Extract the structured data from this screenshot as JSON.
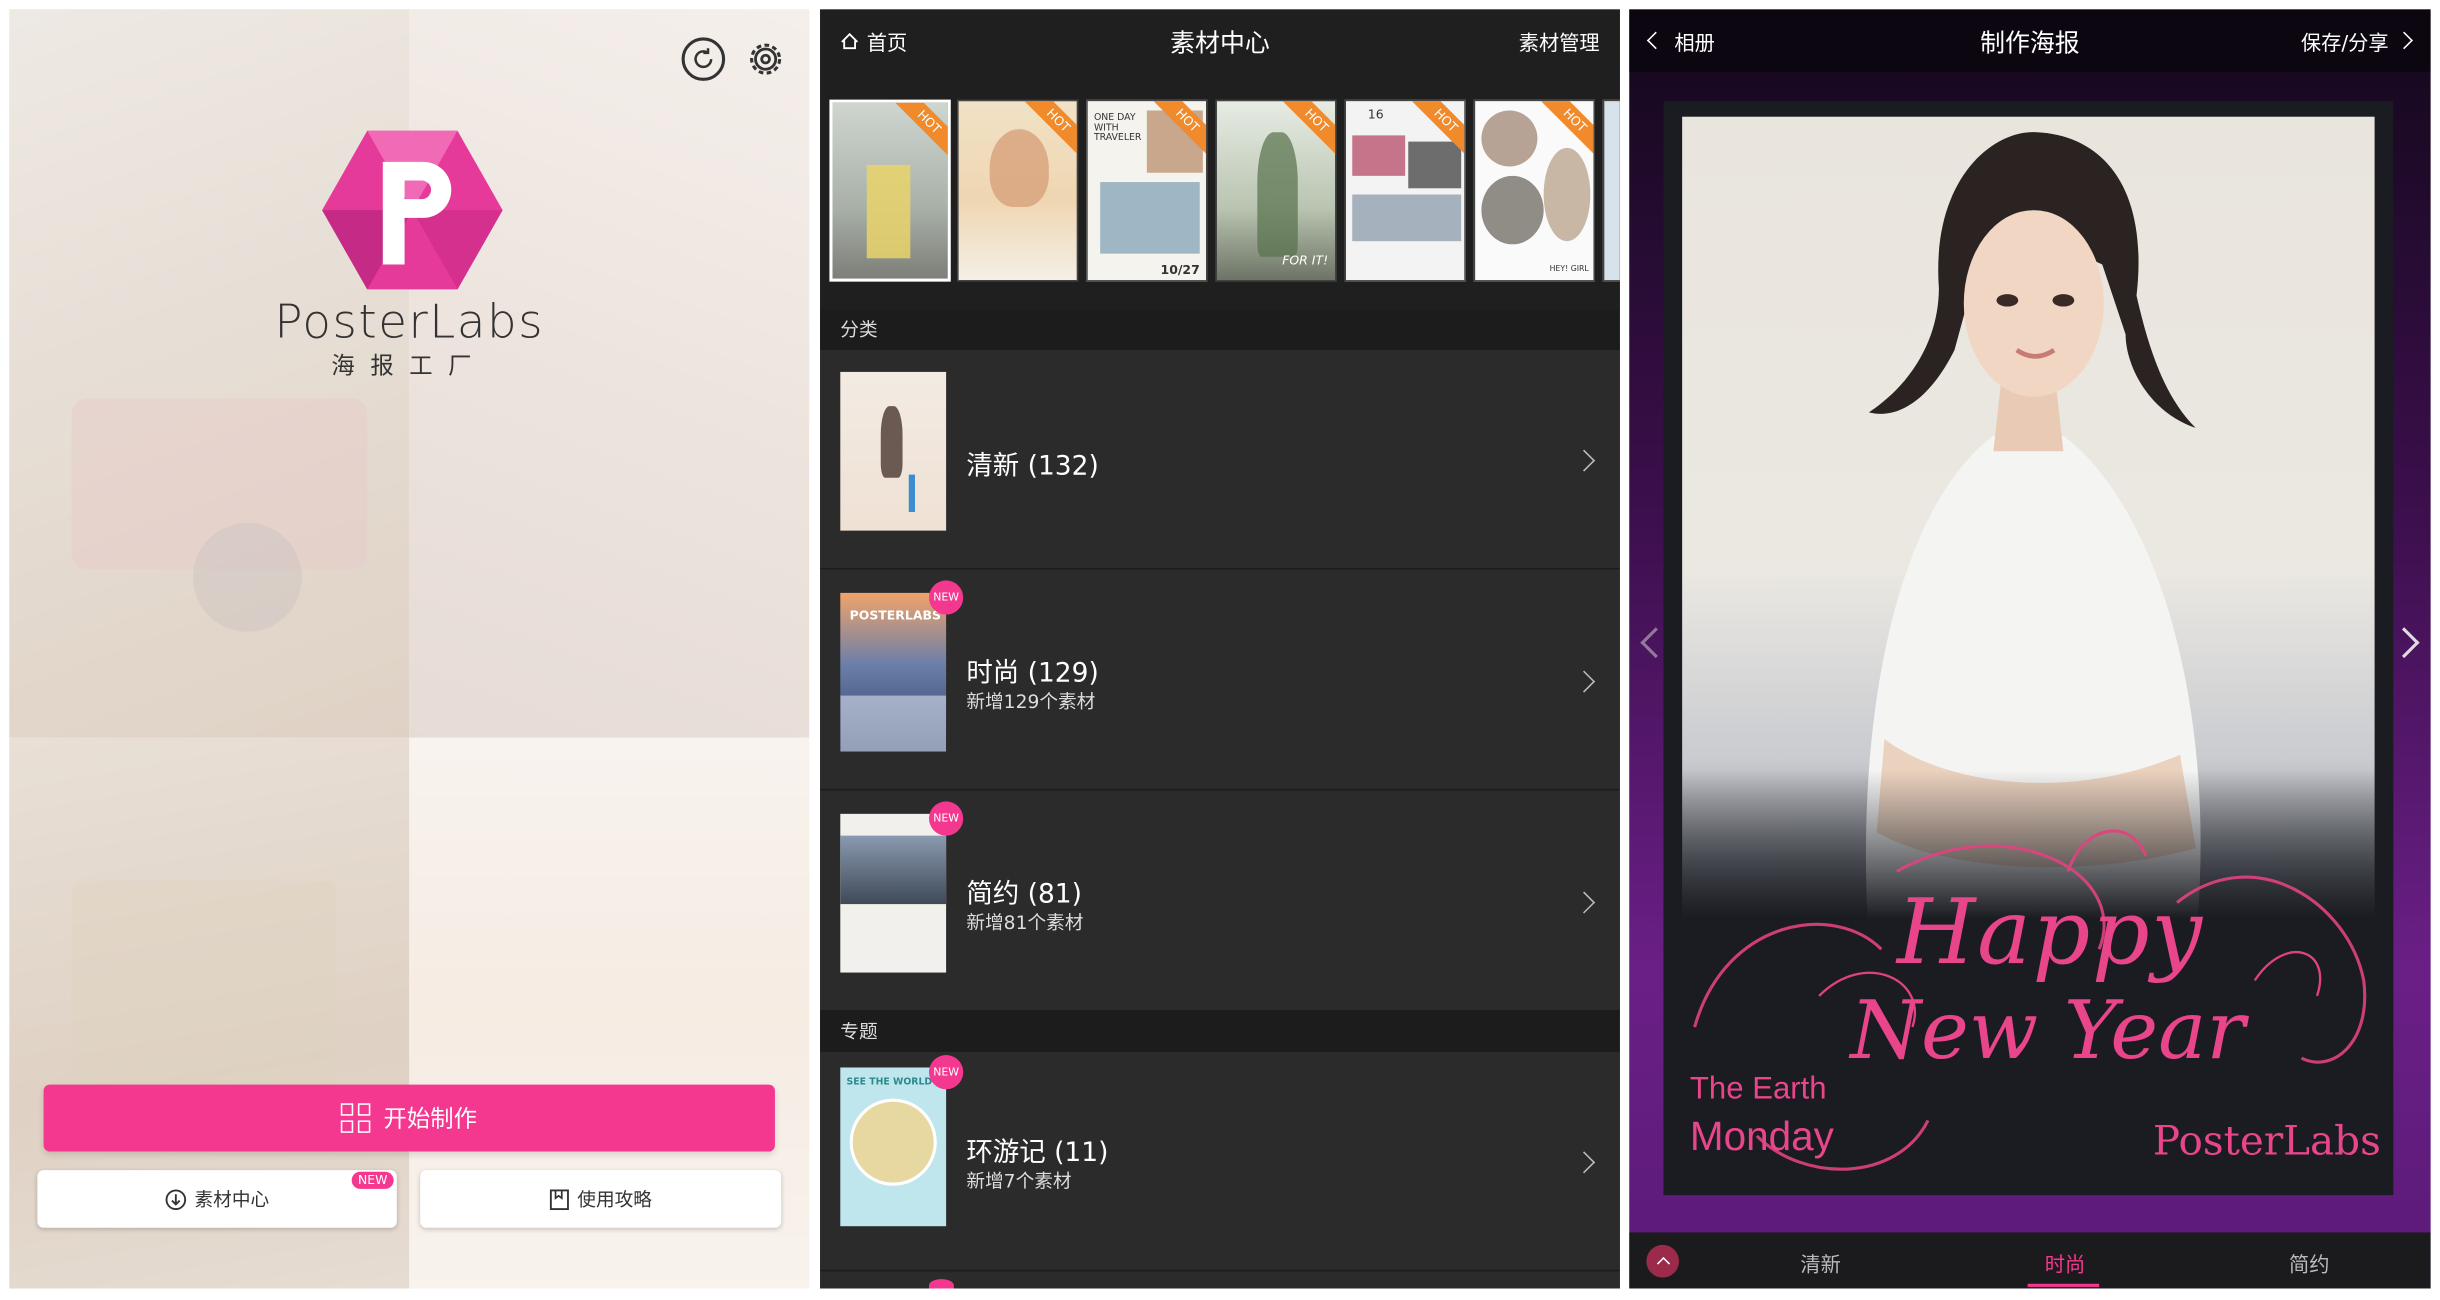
{
  "home": {
    "brand_en": "PosterLabs",
    "brand_cn": "海报工厂",
    "start_label": "开始制作",
    "material_label": "素材中心",
    "material_badge": "NEW",
    "guide_label": "使用攻略",
    "accent": "#f5388f",
    "icons": [
      "refresh-icon",
      "gear-icon",
      "grid-icon",
      "download-icon",
      "bookmark-icon"
    ]
  },
  "material": {
    "back_label": "首页",
    "title": "素材中心",
    "manage_label": "素材管理",
    "hot_tag": "HOT",
    "thumb_texts": {
      "t3a": "ONE DAY WITH TRAVELER",
      "t3b": "10/27",
      "t4": "FOR IT!",
      "t5": "16",
      "t6": "HEY! GIRL"
    },
    "section_category": "分类",
    "section_topic": "专题",
    "categories": [
      {
        "name": "清新 (132)",
        "sub": ""
      },
      {
        "name": "时尚 (129)",
        "sub": "新增129个素材",
        "badge": "NEW",
        "thumb_text": "POSTERLABS"
      },
      {
        "name": "简约 (81)",
        "sub": "新增81个素材",
        "badge": "NEW"
      }
    ],
    "topics": [
      {
        "name": "环游记 (11)",
        "sub": "新增7个素材",
        "badge": "NEW",
        "thumb_text": "SEE THE WORLD"
      }
    ]
  },
  "poster": {
    "back_label": "相册",
    "title": "制作海报",
    "save_label": "保存/分享",
    "text_line1": "The Earth",
    "text_line2": "Monday",
    "script_top": "Happy",
    "script_bottom": "New Year",
    "signature": "PosterLabs",
    "tabs": [
      "清新",
      "时尚",
      "简约"
    ],
    "active_tab": "时尚"
  }
}
